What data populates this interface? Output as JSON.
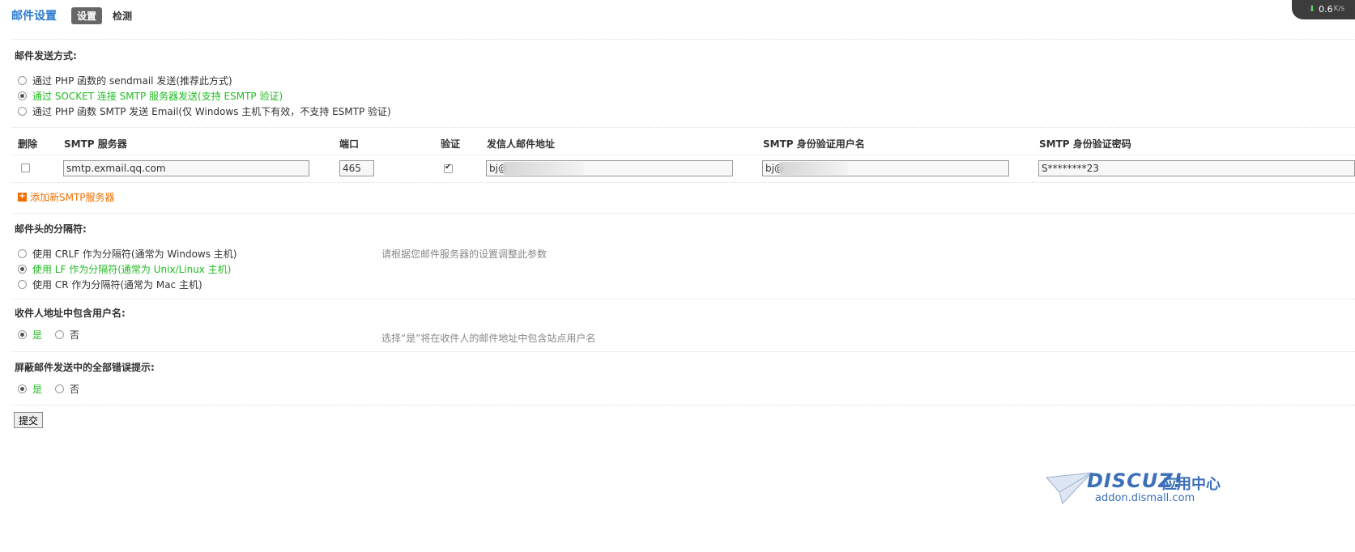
{
  "header": {
    "title": "邮件设置",
    "tabs": [
      {
        "label": "设置",
        "active": true
      },
      {
        "label": "检测",
        "active": false
      }
    ]
  },
  "speed": {
    "value": "0.6",
    "unit": "K/s"
  },
  "send_method": {
    "label": "邮件发送方式:",
    "options": [
      {
        "label": "通过 PHP 函数的 sendmail 发送(推荐此方式)",
        "selected": false
      },
      {
        "label": "通过 SOCKET 连接 SMTP 服务器发送(支持 ESMTP 验证)",
        "selected": true
      },
      {
        "label": "通过 PHP 函数 SMTP 发送 Email(仅 Windows 主机下有效，不支持 ESMTP 验证)",
        "selected": false
      }
    ]
  },
  "smtp_table": {
    "headers": [
      "删除",
      "SMTP 服务器",
      "端口",
      "验证",
      "发信人邮件地址",
      "SMTP 身份验证用户名",
      "SMTP 身份验证密码"
    ],
    "rows": [
      {
        "delete": false,
        "server": "smtp.exmail.qq.com",
        "port": "465",
        "auth": true,
        "from": "bj@",
        "username": "bj@",
        "password": "S********23"
      }
    ],
    "add_label": "添加新SMTP服务器"
  },
  "delimiter": {
    "label": "邮件头的分隔符:",
    "options": [
      {
        "label": "使用 CRLF 作为分隔符(通常为 Windows 主机)",
        "selected": false
      },
      {
        "label": "使用 LF 作为分隔符(通常为 Unix/Linux 主机)",
        "selected": true
      },
      {
        "label": "使用 CR 作为分隔符(通常为 Mac 主机)",
        "selected": false
      }
    ],
    "hint": "请根据您邮件服务器的设置调整此参数"
  },
  "include_username": {
    "label": "收件人地址中包含用户名:",
    "yes": "是",
    "no": "否",
    "value": true,
    "hint": "选择“是”将在收件人的邮件地址中包含站点用户名"
  },
  "silent_errors": {
    "label": "屏蔽邮件发送中的全部错误提示:",
    "yes": "是",
    "no": "否",
    "value": true
  },
  "submit_label": "提交",
  "brand": {
    "name": "DISCUZ!",
    "sub": "应用中心",
    "url": "addon.dismall.com"
  },
  "colors": {
    "accent": "#2b7acd",
    "selected_option": "#22bb22",
    "add_link": "#f06e00"
  }
}
